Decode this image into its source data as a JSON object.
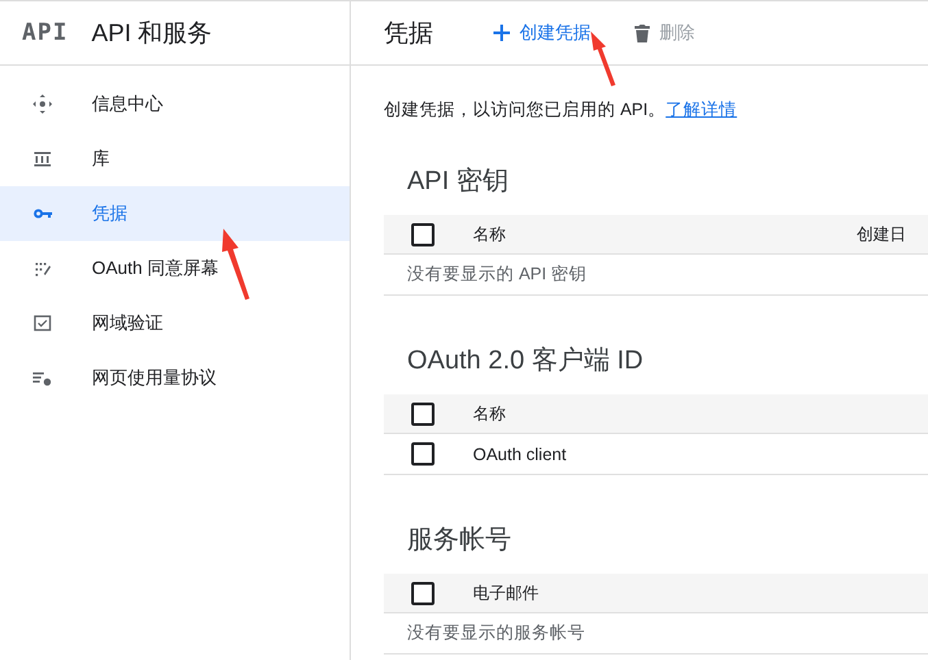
{
  "header": {
    "logo": "API",
    "title": "API 和服务"
  },
  "nav": [
    {
      "kind": "dashboard",
      "label": "信息中心",
      "selected": false
    },
    {
      "kind": "library",
      "label": "库",
      "selected": false
    },
    {
      "kind": "key",
      "label": "凭据",
      "selected": true
    },
    {
      "kind": "consent",
      "label": "OAuth 同意屏幕",
      "selected": false
    },
    {
      "kind": "domain",
      "label": "网域验证",
      "selected": false
    },
    {
      "kind": "agreement",
      "label": "网页使用量协议",
      "selected": false
    }
  ],
  "page": {
    "title": "凭据",
    "actions": [
      {
        "kind": "create",
        "label": "创建凭据"
      },
      {
        "kind": "delete",
        "label": "删除"
      }
    ],
    "intro": "创建凭据，以访问您已启用的 API。",
    "intro_link": "了解详情"
  },
  "sections": [
    {
      "title": "API 密钥",
      "columns": [
        "名称",
        "创建日"
      ],
      "header_checked": false,
      "empty": "没有要显示的 API 密钥"
    },
    {
      "title": "OAuth 2.0 客户端 ID",
      "columns": [
        "名称"
      ],
      "header_checked": false,
      "rows": [
        {
          "name": "OAuth client",
          "checked": false
        }
      ]
    },
    {
      "title": "服务帐号",
      "columns": [
        "电子邮件"
      ],
      "header_checked": false,
      "empty": "没有要显示的服务帐号"
    }
  ]
}
